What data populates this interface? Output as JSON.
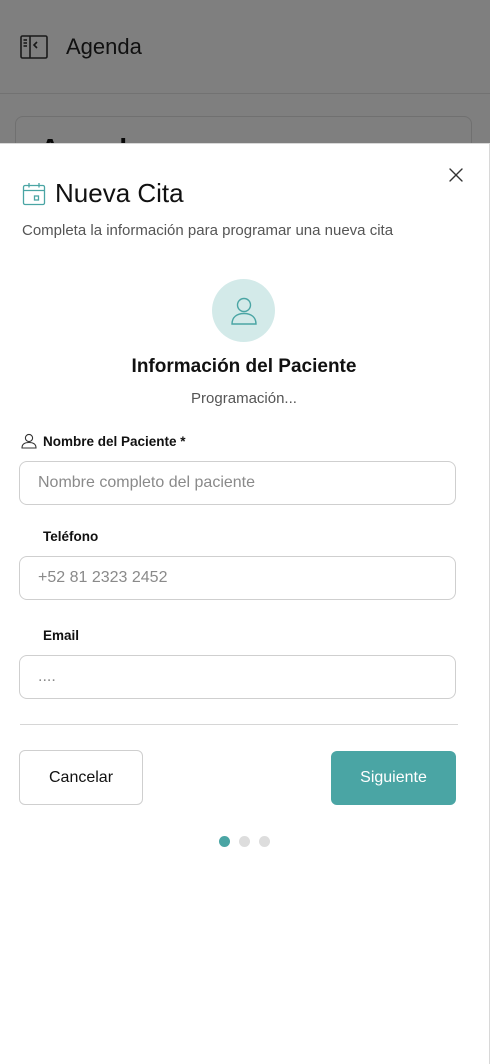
{
  "background": {
    "header_title": "Agenda",
    "card_title": "Agenda"
  },
  "modal": {
    "title": "Nueva Cita",
    "description": "Completa la información para programar una nueva cita",
    "section_title": "Información del Paciente",
    "section_subtitle": "Programación...",
    "fields": {
      "name": {
        "label": "Nombre del Paciente *",
        "placeholder": "Nombre completo del paciente",
        "value": ""
      },
      "phone": {
        "label": "Teléfono",
        "placeholder": "+52 81 2323 2452",
        "value": ""
      },
      "email": {
        "label": "Email",
        "placeholder": "....",
        "value": ""
      }
    },
    "buttons": {
      "cancel": "Cancelar",
      "next": "Siguiente"
    },
    "steps": {
      "total": 3,
      "current": 1
    }
  },
  "colors": {
    "accent": "#4aa5a4",
    "avatar_bg": "#d3eae9",
    "overlay": "rgba(0,0,0,0.5)"
  },
  "icons": {
    "header": "sidebar-toggle-icon",
    "title": "calendar-icon",
    "close": "close-icon",
    "avatar": "user-icon",
    "name_field": "user-icon"
  }
}
